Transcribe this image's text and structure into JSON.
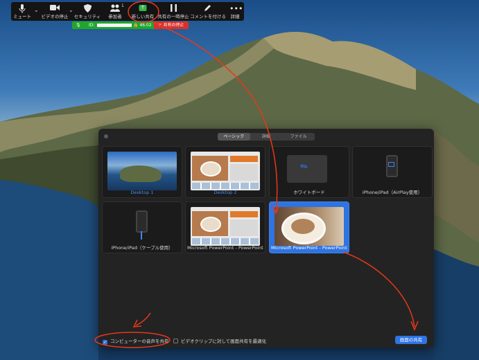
{
  "toolbar": {
    "items": [
      {
        "label": "ミュート",
        "icon": "microphone-icon"
      },
      {
        "label": "ビデオの停止",
        "icon": "video-camera-icon"
      },
      {
        "label": "セキュリティ",
        "icon": "shield-icon"
      },
      {
        "label": "参加者",
        "icon": "participants-icon",
        "count": "1"
      },
      {
        "label": "新しい共有",
        "icon": "share-screen-icon"
      },
      {
        "label": "共有の一時停止",
        "icon": "pause-icon"
      },
      {
        "label": "コメントを付ける",
        "icon": "annotate-icon"
      },
      {
        "label": "詳細",
        "icon": "more-icon"
      }
    ]
  },
  "status_bar": {
    "id_label": "ID:",
    "password": "46.02",
    "stop_share": "共有の停止",
    "colors": {
      "green": "#20a62c",
      "red": "#d6322c"
    }
  },
  "dialog": {
    "tabs": [
      "ベーシック",
      "詳細",
      "ファイル"
    ],
    "active_tab": "ベーシック",
    "tiles": [
      {
        "label": "Desktop 1"
      },
      {
        "label": "Desktop 2"
      },
      {
        "label": "ホワイトボード"
      },
      {
        "label": "iPhone/iPad（AirPlay使用）"
      },
      {
        "label": "iPhone/iPad（ケーブル使用）"
      },
      {
        "label": "Microsoft PowerPoint - PowerPoint..."
      },
      {
        "label": "Microsoft PowerPoint - PowerPoint..."
      }
    ],
    "selected_tile": "Microsoft PowerPoint - PowerPoint... (2)",
    "footer": {
      "share_audio": "コンピューターの音声を共有",
      "share_audio_checked": true,
      "optimize_video": "ビデオクリップに対して画面共有を最適化",
      "optimize_video_checked": false,
      "share_button": "画面の共有"
    },
    "accent_color": "#2f74e0"
  },
  "annotation_color": "#e8381c"
}
